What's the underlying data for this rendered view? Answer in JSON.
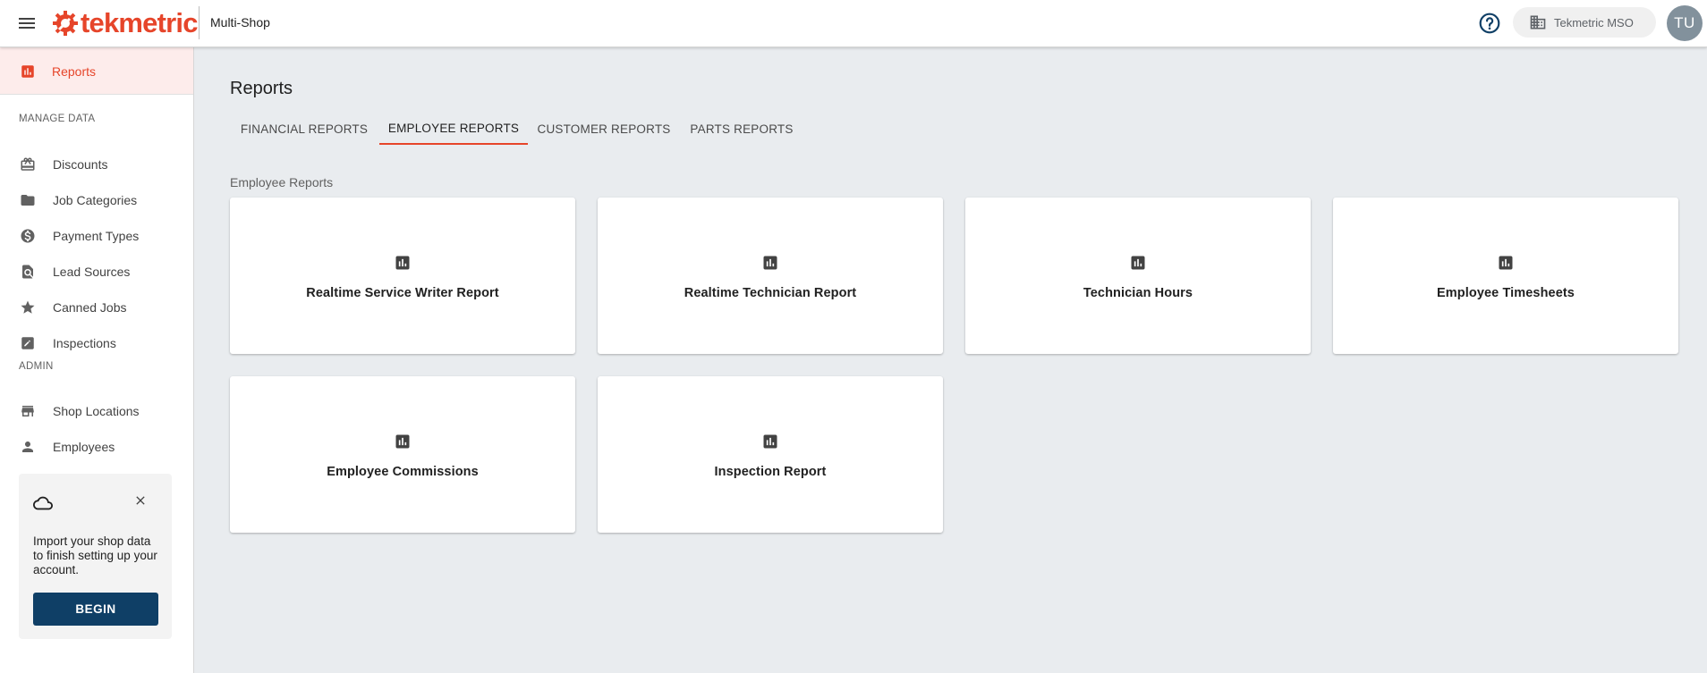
{
  "header": {
    "logo_text": "tekmetric",
    "app_title": "Multi-Shop",
    "org_name": "Tekmetric MSO",
    "avatar_initials": "TU",
    "icons": [
      "menu-icon",
      "help-circle-icon",
      "building-icon"
    ]
  },
  "sidebar": {
    "reports_label": "Reports",
    "manage_data_heading": "MANAGE DATA",
    "manage_items": [
      {
        "label": "Discounts",
        "icon": "gift-icon"
      },
      {
        "label": "Job Categories",
        "icon": "folder-icon"
      },
      {
        "label": "Payment Types",
        "icon": "dollar-circle-icon"
      },
      {
        "label": "Lead Sources",
        "icon": "search-doc-icon"
      },
      {
        "label": "Canned Jobs",
        "icon": "star-icon"
      },
      {
        "label": "Inspections",
        "icon": "edit-square-icon"
      }
    ],
    "admin_heading": "ADMIN",
    "admin_items": [
      {
        "label": "Shop Locations",
        "icon": "store-icon"
      },
      {
        "label": "Employees",
        "icon": "person-icon"
      }
    ],
    "import_card": {
      "message": "Import your shop data to finish setting up your account.",
      "button_label": "BEGIN"
    }
  },
  "main": {
    "title": "Reports",
    "tabs": [
      {
        "label": "FINANCIAL REPORTS",
        "active": false
      },
      {
        "label": "EMPLOYEE REPORTS",
        "active": true
      },
      {
        "label": "CUSTOMER REPORTS",
        "active": false
      },
      {
        "label": "PARTS REPORTS",
        "active": false
      }
    ],
    "section_label": "Employee Reports",
    "cards": [
      {
        "title": "Realtime Service Writer Report"
      },
      {
        "title": "Realtime Technician Report"
      },
      {
        "title": "Technician Hours"
      },
      {
        "title": "Employee Timesheets"
      },
      {
        "title": "Employee Commissions"
      },
      {
        "title": "Inspection Report"
      }
    ]
  },
  "colors": {
    "brand": "#e6452a",
    "primary_button": "#0f3f66",
    "background": "#e9ecef"
  }
}
